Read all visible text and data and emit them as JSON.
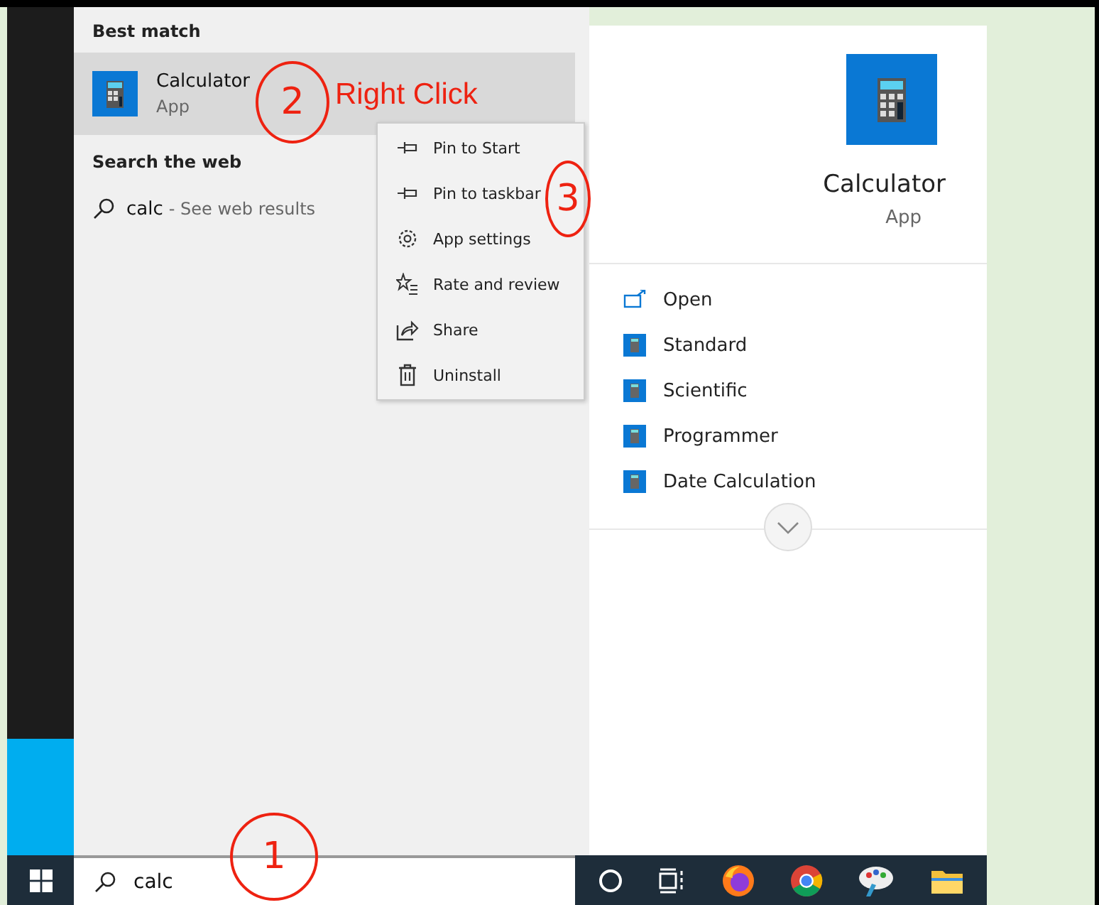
{
  "results": {
    "best_match_heading": "Best match",
    "best_match": {
      "title": "Calculator",
      "subtitle": "App",
      "selected": true
    },
    "web_heading": "Search the web",
    "web_result": {
      "query": "calc",
      "suffix": "- See web results"
    }
  },
  "context_menu": [
    {
      "kind": "pin",
      "label": "Pin to Start"
    },
    {
      "kind": "pin",
      "label": "Pin to taskbar"
    },
    {
      "kind": "gear",
      "label": "App settings"
    },
    {
      "kind": "star",
      "label": "Rate and review"
    },
    {
      "kind": "share",
      "label": "Share"
    },
    {
      "kind": "trash",
      "label": "Uninstall"
    }
  ],
  "preview": {
    "title": "Calculator",
    "subtitle": "App",
    "actions": [
      {
        "kind": "open",
        "label": "Open"
      },
      {
        "kind": "calc",
        "label": "Standard"
      },
      {
        "kind": "calc",
        "label": "Scientific"
      },
      {
        "kind": "calc",
        "label": "Programmer"
      },
      {
        "kind": "calc",
        "label": "Date Calculation"
      }
    ]
  },
  "search_box": {
    "value": "calc"
  },
  "taskbar": [
    {
      "kind": "cortana"
    },
    {
      "kind": "taskview"
    },
    {
      "kind": "firefox"
    },
    {
      "kind": "chrome"
    },
    {
      "kind": "paint"
    },
    {
      "kind": "folder"
    }
  ],
  "annotations": {
    "circled_numbers": [
      "2",
      "3",
      "1"
    ],
    "note": "Right Click"
  }
}
